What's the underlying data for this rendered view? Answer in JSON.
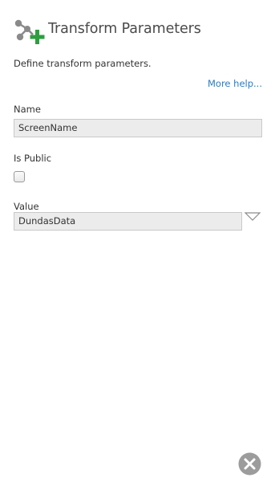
{
  "header": {
    "title": "Transform Parameters",
    "icon": "transform-add-icon",
    "icon_colors": {
      "nodes": "#8a8a8a",
      "plus": "#2e9e3f"
    }
  },
  "description": "Define transform parameters.",
  "help_link": {
    "label": "More help...",
    "color": "#2b7bc0"
  },
  "fields": {
    "name": {
      "label": "Name",
      "value": "ScreenName"
    },
    "is_public": {
      "label": "Is Public",
      "checked": false
    },
    "value": {
      "label": "Value",
      "value": "DundasData"
    }
  },
  "icons": {
    "dropdown": "chevron-down-icon",
    "close": "close-icon"
  }
}
